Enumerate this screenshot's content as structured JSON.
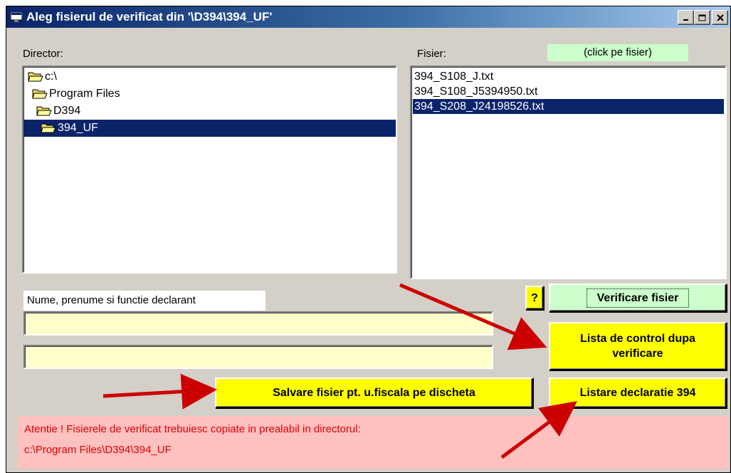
{
  "window": {
    "title": "Aleg fisierul de verificat din '\\D394\\394_UF'"
  },
  "director": {
    "label": "Director:",
    "items": [
      {
        "label": "c:\\",
        "icon": "open-folder-icon"
      },
      {
        "label": "Program Files",
        "icon": "open-folder-icon"
      },
      {
        "label": "D394",
        "icon": "open-folder-icon"
      },
      {
        "label": "394_UF",
        "icon": "open-folder-icon",
        "selected": true
      }
    ]
  },
  "fisier": {
    "label": "Fisier:",
    "hint": "(click pe fisier)",
    "items": [
      {
        "label": "394_S108_J.txt"
      },
      {
        "label": "394_S108_J5394950.txt"
      },
      {
        "label": "394_S208_J24198526.txt",
        "selected": true
      }
    ]
  },
  "declarant": {
    "label": "Nume, prenume si functie declarant",
    "line1": "",
    "line2": ""
  },
  "buttons": {
    "help": "?",
    "verificare": "Verificare fisier",
    "lista_control": "Lista de control dupa verificare",
    "salvare": "Salvare fisier pt. u.fiscala pe discheta",
    "listare": "Listare declaratie 394"
  },
  "warning": {
    "line1": "Atentie ! Fisierele de verificat trebuiesc copiate in prealabil in directorul:",
    "line2": "c:\\Program Files\\D394\\394_UF"
  },
  "colors": {
    "title_bar": "#0a246a",
    "button_yellow": "#ffff00",
    "verificare_green": "#ccffcc",
    "hint_green": "#ccffcc",
    "field_yellow": "#ffffcc",
    "warning_bg": "#ffc0c0",
    "warning_text": "#e00000",
    "selection": "#0a246a",
    "arrow": "#cc0000"
  }
}
